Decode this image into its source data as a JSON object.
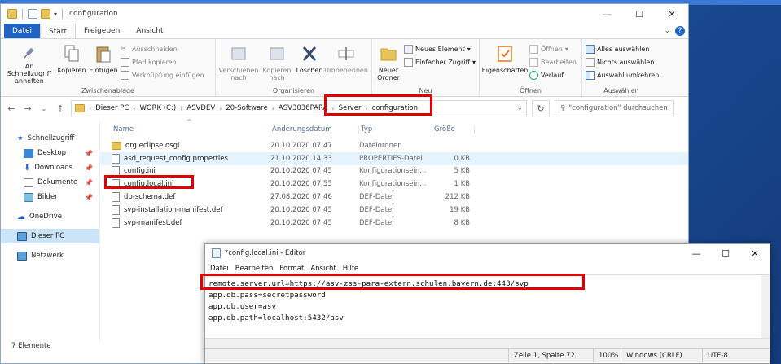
{
  "explorer": {
    "title": "configuration",
    "tabs": [
      "Datei",
      "Start",
      "Freigeben",
      "Ansicht"
    ],
    "ribbon": {
      "clipboard": {
        "label": "Zwischenablage",
        "pin": "An Schnellzugriff anheften",
        "copy": "Kopieren",
        "paste": "Einfügen",
        "cut": "Ausschneiden",
        "copypath": "Pfad kopieren",
        "pasteshortcut": "Verknüpfung einfügen"
      },
      "organize": {
        "label": "Organisieren",
        "move": "Verschieben nach",
        "copyto": "Kopieren nach",
        "delete": "Löschen",
        "rename": "Umbenennen"
      },
      "new": {
        "label": "Neu",
        "newfolder": "Neuer Ordner",
        "newitem": "Neues Element",
        "easyaccess": "Einfacher Zugriff"
      },
      "open": {
        "label": "Öffnen",
        "properties": "Eigenschaften",
        "open": "Öffnen",
        "edit": "Bearbeiten",
        "history": "Verlauf"
      },
      "select": {
        "label": "Auswählen",
        "all": "Alles auswählen",
        "none": "Nichts auswählen",
        "invert": "Auswahl umkehren"
      }
    },
    "path": [
      "Dieser PC",
      "WORK (C:)",
      "ASVDEV",
      "20-Software",
      "ASV3036PARA",
      "Server",
      "configuration"
    ],
    "search_placeholder": "\"configuration\" durchsuchen",
    "nav": {
      "quick": "Schnellzugriff",
      "desktop": "Desktop",
      "downloads": "Downloads",
      "documents": "Dokumente",
      "pictures": "Bilder",
      "onedrive": "OneDrive",
      "thispc": "Dieser PC",
      "network": "Netzwerk"
    },
    "columns": {
      "name": "Name",
      "date": "Änderungsdatum",
      "type": "Typ",
      "size": "Größe"
    },
    "files": [
      {
        "name": "org.eclipse.osgi",
        "date": "20.10.2020 07:47",
        "type": "Dateiordner",
        "size": ""
      },
      {
        "name": "asd_request_config.properties",
        "date": "21.10.2020 14:33",
        "type": "PROPERTIES-Datei",
        "size": "0 KB"
      },
      {
        "name": "config.ini",
        "date": "20.10.2020 07:45",
        "type": "Konfigurationsein...",
        "size": "5 KB"
      },
      {
        "name": "config.local.ini",
        "date": "20.10.2020 07:55",
        "type": "Konfigurationsein...",
        "size": "1 KB"
      },
      {
        "name": "db-schema.def",
        "date": "27.08.2020 07:46",
        "type": "DEF-Datei",
        "size": "212 KB"
      },
      {
        "name": "svp-installation-manifest.def",
        "date": "20.10.2020 07:45",
        "type": "DEF-Datei",
        "size": "19 KB"
      },
      {
        "name": "svp-manifest.def",
        "date": "20.10.2020 07:45",
        "type": "DEF-Datei",
        "size": "8 KB"
      }
    ],
    "status": "7 Elemente"
  },
  "editor": {
    "title": "*config.local.ini - Editor",
    "menu": [
      "Datei",
      "Bearbeiten",
      "Format",
      "Ansicht",
      "Hilfe"
    ],
    "lines": [
      "remote.server.url=https://asv-zss-para-extern.schulen.bayern.de:443/svp",
      "app.db.pass=secretpassword",
      "app.db.user=asv",
      "app.db.path=localhost:5432/asv"
    ],
    "status": {
      "pos": "Zeile 1, Spalte 72",
      "zoom": "100%",
      "eol": "Windows (CRLF)",
      "enc": "UTF-8"
    }
  },
  "colors": {
    "accent": "#1f64c4",
    "highlight": "#e00000"
  }
}
